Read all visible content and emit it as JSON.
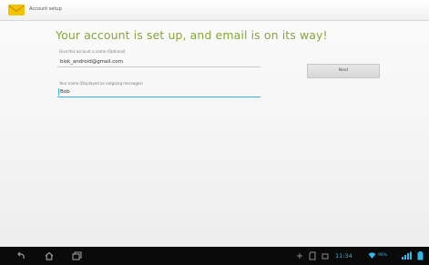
{
  "window": {
    "title": "Account setup"
  },
  "heading": "Your account is set up, and email is on its way!",
  "form": {
    "account_label": "Give this account a name (Optional)",
    "account_value": "bisk_android@gmail.com",
    "name_label": "Your name (Displayed on outgoing messages)",
    "name_value": "Bob"
  },
  "buttons": {
    "next_label": "Next"
  },
  "status_bar": {
    "time": "11:34",
    "battery_text": "96%",
    "accent": "#33b5e5"
  },
  "colors": {
    "heading": "#88a63c",
    "accent": "#33b5e5",
    "navbar": "#0a0a0a"
  },
  "icons": [
    "app-email-icon",
    "back-icon",
    "home-icon",
    "recent-apps-icon",
    "wifi-icon",
    "signal-icon",
    "battery-icon"
  ]
}
